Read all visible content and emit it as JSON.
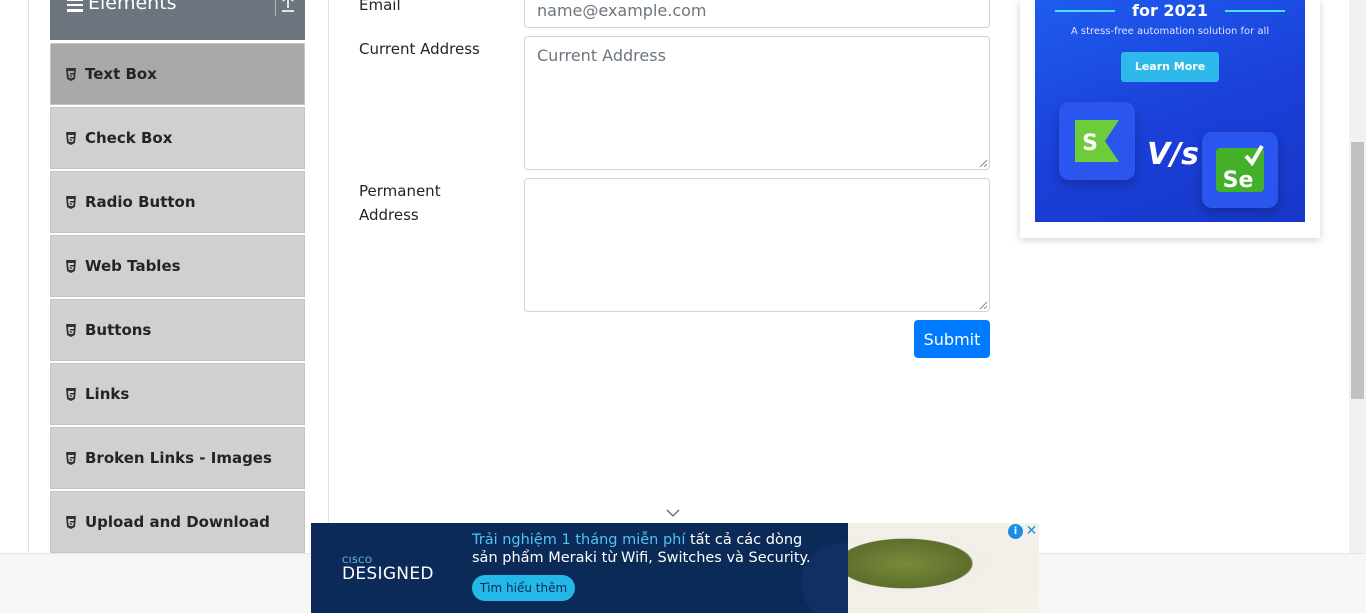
{
  "sidebar": {
    "group_title": "Elements",
    "items": [
      {
        "label": "Text Box",
        "active": true
      },
      {
        "label": "Check Box",
        "active": false
      },
      {
        "label": "Radio Button",
        "active": false
      },
      {
        "label": "Web Tables",
        "active": false
      },
      {
        "label": "Buttons",
        "active": false
      },
      {
        "label": "Links",
        "active": false
      },
      {
        "label": "Broken Links - Images",
        "active": false
      },
      {
        "label": "Upload and Download",
        "active": false
      }
    ]
  },
  "form": {
    "email_label": "Email",
    "email_placeholder": "name@example.com",
    "current_address_label": "Current Address",
    "current_address_placeholder": "Current Address",
    "permanent_address_label_line1": "Permanent",
    "permanent_address_label_line2": "Address",
    "permanent_address_value": "",
    "submit_label": "Submit"
  },
  "side_ad": {
    "headline": "for 2021",
    "subtext": "A stress-free automation solution for all",
    "cta": "Learn More",
    "vs": "V/s",
    "colors": {
      "background": "#1f5cf0",
      "cta": "#2fb8ea",
      "katalon": "#6ecb3a",
      "selenium": "#43b02a"
    }
  },
  "bottom_ad": {
    "brand_small": "CISCO",
    "brand_big": "DESIGNED",
    "line1_highlight": "Trải nghiệm 1 tháng miễn phí",
    "line1_rest": " tất cả các dòng",
    "line2": "sản phẩm Meraki từ Wifi, Switches và Security.",
    "cta": "Tìm hiểu thêm",
    "adchoices": "i",
    "close": "✕"
  },
  "colors": {
    "accent": "#007bff",
    "sidebar_header": "#6c757d",
    "menu_item": "#d0d0d0",
    "menu_item_active": "#a9a9a9"
  }
}
